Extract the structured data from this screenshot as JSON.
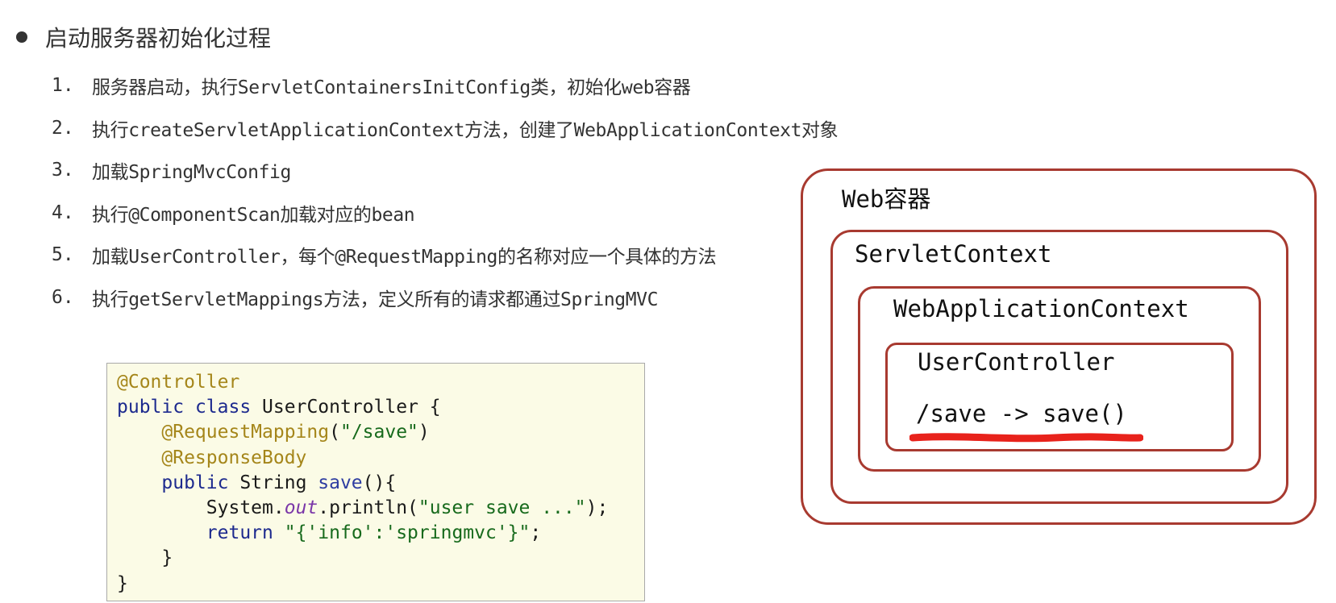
{
  "heading": "启动服务器初始化过程",
  "steps": [
    {
      "num": "1.",
      "text": "服务器启动，执行ServletContainersInitConfig类，初始化web容器"
    },
    {
      "num": "2.",
      "text": "执行createServletApplicationContext方法，创建了WebApplicationContext对象"
    },
    {
      "num": "3.",
      "text": "加载SpringMvcConfig"
    },
    {
      "num": "4.",
      "text": "执行@ComponentScan加载对应的bean"
    },
    {
      "num": "5.",
      "text": "加载UserController，每个@RequestMapping的名称对应一个具体的方法"
    },
    {
      "num": "6.",
      "text": "执行getServletMappings方法，定义所有的请求都通过SpringMVC"
    }
  ],
  "code": {
    "l1_ann": "@Controller",
    "l2_kw1": "public",
    "l2_kw2": "class",
    "l2_rest": " UserController {",
    "l3_ann": "@RequestMapping",
    "l3_open": "(",
    "l3_str": "\"/save\"",
    "l3_close": ")",
    "l4_ann": "@ResponseBody",
    "l5_kw": "public",
    "l5_type": " String ",
    "l5_meth": "save",
    "l5_rest": "(){",
    "l6_obj": "System.",
    "l6_fld": "out",
    "l6_call": ".println(",
    "l6_str": "\"user save ...\"",
    "l6_end": ");",
    "l7_kw": "return",
    "l7_str": "\"{'info':'springmvc'}\"",
    "l7_end": ";",
    "l8": "}",
    "l9": "}"
  },
  "diagram": {
    "web_container": "Web容器",
    "servlet_context": "ServletContext",
    "web_app_context": "WebApplicationContext",
    "user_controller": "UserController",
    "mapping": "/save -> save()"
  },
  "colors": {
    "box_border": "#a83a30",
    "underline": "#e8221b",
    "code_bg": "#fbfbe6"
  }
}
